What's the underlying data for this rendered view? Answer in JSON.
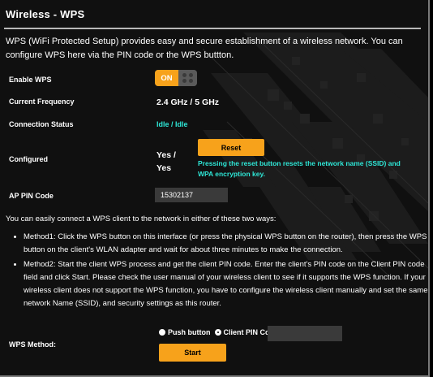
{
  "title": "Wireless - WPS",
  "description": "WPS (WiFi Protected Setup) provides easy and secure establishment of a wireless network. You can configure WPS here via the PIN code or the WPS buttton.",
  "enable_wps": {
    "label": "Enable WPS",
    "toggle_text": "ON"
  },
  "current_frequency": {
    "label": "Current Frequency",
    "value": "2.4 GHz / 5 GHz"
  },
  "connection_status": {
    "label": "Connection Status",
    "value": "Idle / Idle"
  },
  "configured": {
    "label": "Configured",
    "value_line1": "Yes /",
    "value_line2": "Yes",
    "reset_button": "Reset",
    "reset_note": "Pressing the reset button resets the network name (SSID) and WPA encryption key."
  },
  "ap_pin": {
    "label": "AP PIN Code",
    "value": "15302137"
  },
  "methods_intro": "You can easily connect a WPS client to the network in either of these two ways:",
  "methods": [
    "Method1: Click the WPS button on this interface (or press the physical WPS button on the router), then press the WPS button on the client's WLAN adapter and wait for about three minutes to make the connection.",
    "Method2: Start the client WPS process and get the client PIN code. Enter the client's PIN code on the Client PIN code field and click Start. Please check the user manual of your wireless client to see if it supports the WPS function. If your wireless client does not support the WPS function, you have to configure the wireless client manually and set the same network Name (SSID), and security settings as this router."
  ],
  "wps_method": {
    "label": "WPS Method:",
    "option_push": "Push button",
    "option_pin": "Client PIN Code",
    "selected": "Client PIN Code",
    "client_pin_value": "",
    "start_button": "Start"
  },
  "colors": {
    "accent": "#f7a21b",
    "status": "#2ee6d6",
    "background": "#101010"
  }
}
